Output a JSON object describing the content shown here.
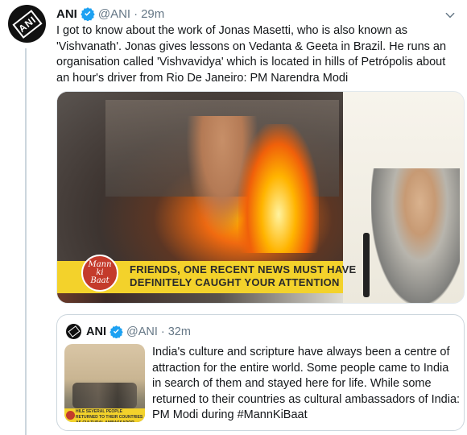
{
  "tweet": {
    "author_name": "ANI",
    "author_handle": "@ANI",
    "separator": "·",
    "time": "29m",
    "text": "I got to know about the work of Jonas Masetti, who is also known as 'Vishvanath'. Jonas gives lessons on Vedanta & Geeta in Brazil. He runs an organisation called 'Vishvavidya' which is located in hills of Petrópolis about an hour's driver from Rio De Janeiro: PM Narendra Modi",
    "avatar_logo_text": "ANI",
    "media": {
      "banner_logo_line1": "Mann",
      "banner_logo_line2": "ki",
      "banner_logo_line3": "Baat",
      "banner_text": "FRIENDS, ONE RECENT NEWS MUST HAVE DEFINITELY CAUGHT YOUR ATTENTION"
    }
  },
  "quoted_tweet": {
    "author_name": "ANI",
    "author_handle": "@ANI",
    "separator": "·",
    "time": "32m",
    "text": "India's culture and scripture have always been a centre of attraction for the entire world. Some people came to India in search of them and stayed here for life. While some returned to their countries as cultural ambassadors of India: PM Modi during #MannKiBaat",
    "thumb_strip_text": "HILE SEVERAL PEOPLE RETURNED TO THEIR COUNTRIES AS CULTURAL AMBASSADOR"
  },
  "colors": {
    "verified_blue": "#1da1f2",
    "muted_text": "#657786",
    "banner_yellow": "#f3d22b"
  },
  "icons": {
    "verified": "verified-badge-icon",
    "more": "chevron-down-icon"
  }
}
